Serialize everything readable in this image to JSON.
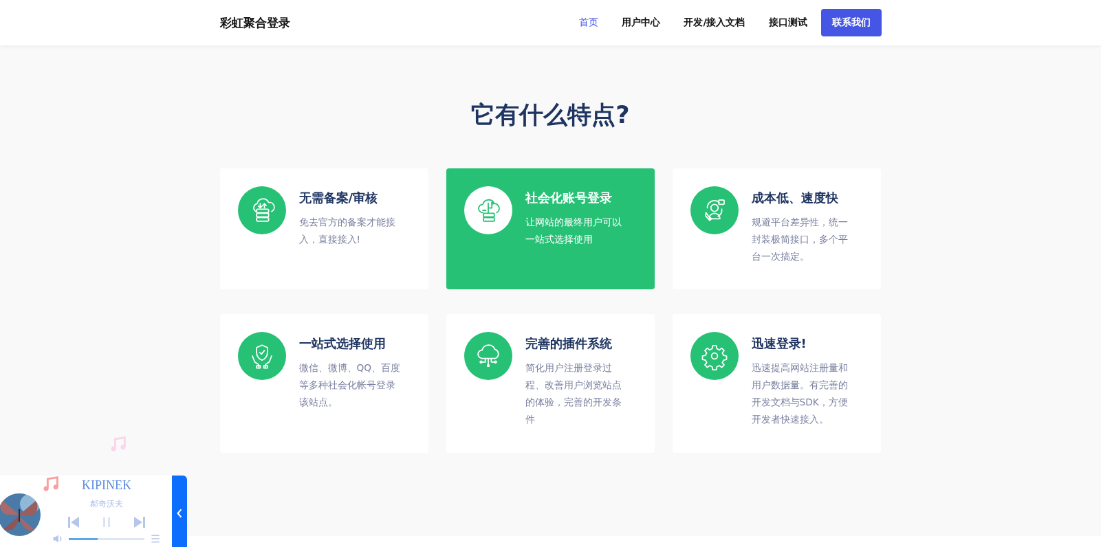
{
  "header": {
    "logo": "彩虹聚合登录",
    "nav": [
      {
        "label": "首页",
        "selected": true
      },
      {
        "label": "用户中心",
        "selected": false
      },
      {
        "label": "开发/接入文档",
        "selected": false
      },
      {
        "label": "接口测试",
        "selected": false
      }
    ],
    "contact_button": "联系我们"
  },
  "section": {
    "title": "它有什么特点?",
    "features": [
      {
        "title": "无需备案/审核",
        "text": "免去官方的备案才能接入，直接接入!",
        "highlighted": false
      },
      {
        "title": "社会化账号登录",
        "text": "让网站的最终用户可以一站式选择使用",
        "highlighted": true
      },
      {
        "title": "成本低、速度快",
        "text": "规避平台差异性，统一封装极简接口，多个平台一次搞定。",
        "highlighted": false
      },
      {
        "title": "一站式选择使用",
        "text": "微信、微博、QQ、百度等多种社会化帐号登录该站点。",
        "highlighted": false
      },
      {
        "title": "完善的插件系统",
        "text": "简化用户注册登录过程、改善用户浏览站点的体验，完善的开发条件",
        "highlighted": false
      },
      {
        "title": "迅速登录!",
        "text": "迅速提高网站注册量和用户数据量。有完善的开发文档与SDK，方便开发者快速接入。",
        "highlighted": false
      }
    ]
  },
  "music_player": {
    "song": "KIPINEK",
    "artist": "郝奇沃夫",
    "playing": true,
    "volume": {
      "level": 0.38
    }
  }
}
